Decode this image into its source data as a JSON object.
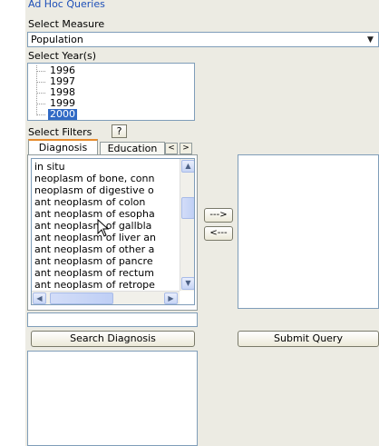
{
  "group_title": "Ad Hoc Queries",
  "measure": {
    "label": "Select Measure",
    "value": "Population"
  },
  "years": {
    "label": "Select Year(s)",
    "items": [
      "1996",
      "1997",
      "1998",
      "1999",
      "2000"
    ],
    "selected": "2000"
  },
  "filters": {
    "label": "Select Filters",
    "help_label": "?",
    "tabs": [
      "Diagnosis",
      "Education"
    ],
    "active_tab": "Diagnosis",
    "tab_prev": "<",
    "tab_next": ">",
    "diagnosis_items": [
      "in situ",
      "neoplasm of bone, conn",
      "neoplasm of digestive o",
      "ant neoplasm of colon",
      "ant neoplasm of esopha",
      "ant neoplasm of gallbla",
      "ant neoplasm of liver an",
      "ant neoplasm of other a",
      "ant neoplasm of pancre",
      "ant neoplasm of rectum",
      "ant neoplasm of retrope"
    ]
  },
  "transfer": {
    "add_label": "--->",
    "remove_label": "<---"
  },
  "search": {
    "input_value": "",
    "button_label": "Search Diagnosis"
  },
  "submit": {
    "button_label": "Submit Query"
  },
  "colors": {
    "panel": "#ecebe3",
    "selection": "#316ac5",
    "group_title": "#1d4fb8",
    "active_tab_accent": "#e68b2c"
  }
}
